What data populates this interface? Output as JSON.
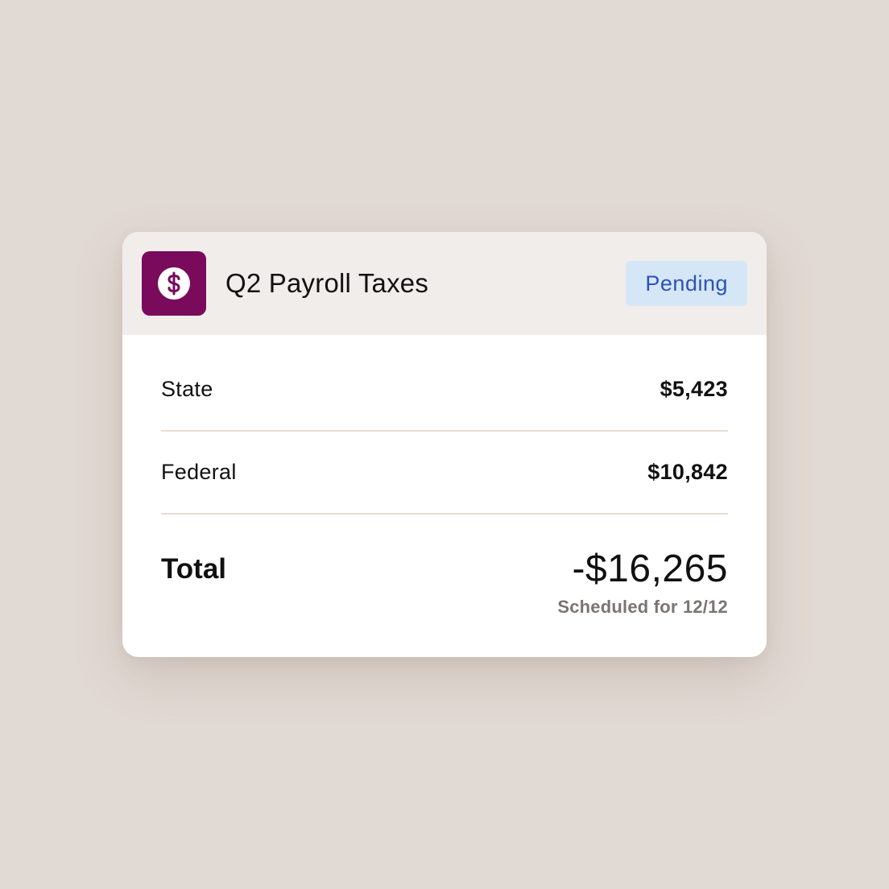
{
  "card": {
    "title": "Q2 Payroll Taxes",
    "icon": "dollar-sign-icon",
    "status": "Pending",
    "colors": {
      "icon_bg": "#7a0a5c",
      "badge_bg": "#d5e7f6",
      "badge_text": "#2c53b4",
      "header_bg": "#f1edea",
      "page_bg": "#e1d9d3"
    }
  },
  "rows": [
    {
      "label": "State",
      "value": "$5,423"
    },
    {
      "label": "Federal",
      "value": "$10,842"
    }
  ],
  "total": {
    "label": "Total",
    "value": "-$16,265",
    "scheduled": "Scheduled for 12/12"
  }
}
